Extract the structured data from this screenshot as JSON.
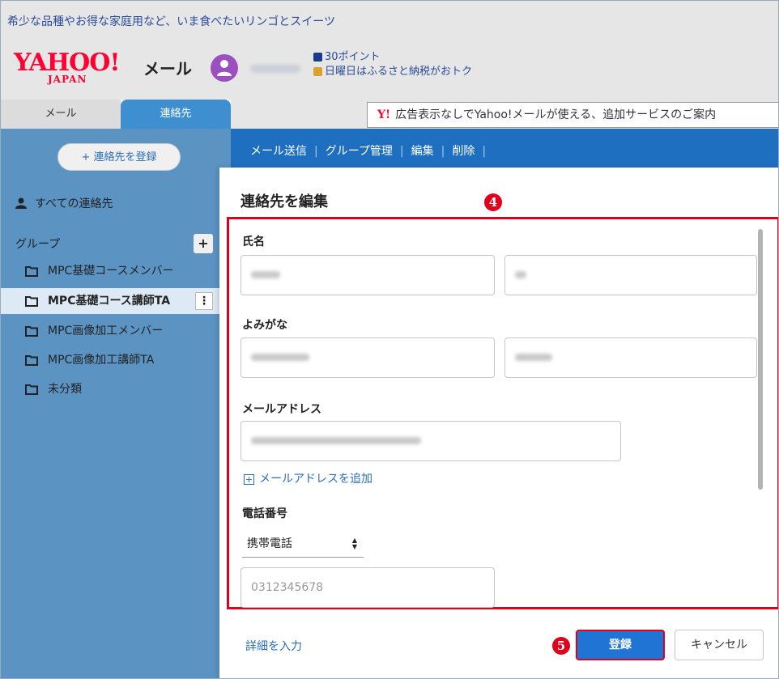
{
  "promo": {
    "text": "希少な品種やお得な家庭用など、いま食べたいリンゴとスイーツ"
  },
  "header": {
    "logo_main": "YAHOO!",
    "logo_sub": "JAPAN",
    "app_name": "メール",
    "points": "30ポイント",
    "furusato": "日曜日はふるさと納税がおトク"
  },
  "tabs": [
    {
      "label": "メール"
    },
    {
      "label": "連絡先"
    }
  ],
  "ad": {
    "logo": "Y!",
    "text": "広告表示なしでYahoo!メールが使える、追加サービスのご案内"
  },
  "sidebar": {
    "add_contact": "+ 連絡先を登録",
    "all_contacts": "すべての連絡先",
    "group_label": "グループ",
    "group_add": "+",
    "groups": [
      {
        "label": "MPC基礎コースメンバー"
      },
      {
        "label": "MPC基礎コース講師TA"
      },
      {
        "label": "MPC画像加工メンバー"
      },
      {
        "label": "MPC画像加工講師TA"
      },
      {
        "label": "未分類"
      }
    ],
    "kebab": "⋮"
  },
  "actions": {
    "send_mail": "メール送信",
    "group_manage": "グループ管理",
    "edit": "編集",
    "delete": "削除",
    "separator": "|"
  },
  "modal": {
    "title": "連絡先を編集",
    "marker_4": "4",
    "marker_5": "5",
    "name_label": "氏名",
    "furigana_label": "よみがな",
    "email_label": "メールアドレス",
    "add_email": "メールアドレスを追加",
    "phone_label": "電話番号",
    "phone_type": "携帯電話",
    "phone_placeholder": "0312345678",
    "detail_link": "詳細を入力",
    "save": "登録",
    "cancel": "キャンセル"
  },
  "colors": {
    "accent_red": "#e0001b",
    "sidebar_blue": "#5b93c3",
    "action_blue": "#1f6fc0",
    "button_blue": "#1f74d4",
    "link_blue": "#2a6fb8"
  }
}
